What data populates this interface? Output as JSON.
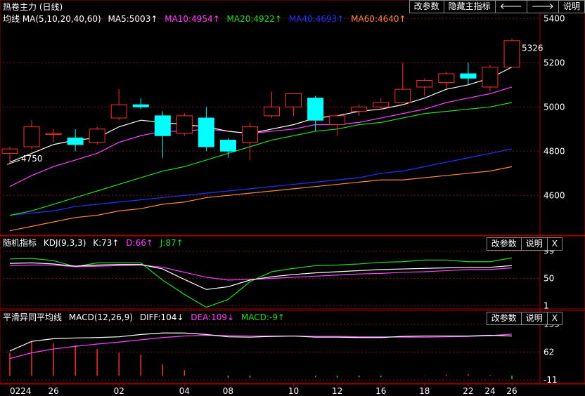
{
  "toolbar": {
    "params": "改参数",
    "hide": "隐藏主指标",
    "left": "🡐",
    "right": "🡒",
    "explain": "说明"
  },
  "main_panel": {
    "title": "热卷主力 (日线)",
    "ma_label": "均线 MA(5,10,20,40,60)",
    "ma5": "MA5:5003↑",
    "ma10": "MA10:4954↑",
    "ma20": "MA20:4922↑",
    "ma40": "MA40:4693↑",
    "ma60": "MA60:4640↑",
    "y_ticks": [
      "5400",
      "5200",
      "5000",
      "4800",
      "4600"
    ],
    "low_annotation": "4750",
    "high_annotation": "5326"
  },
  "kdj_panel": {
    "name": "随机指标",
    "params": "KDJ(9,3,3)",
    "k": "K:73↑",
    "d": "D:66↑",
    "j": "J:87↑",
    "btn_params": "改参数",
    "btn_explain": "说明",
    "btn_close": "X",
    "y_ticks": [
      "99",
      "50",
      "1"
    ]
  },
  "macd_panel": {
    "name": "平滑异同平均线",
    "params": "MACD(12,26,9)",
    "diff": "DIFF:104↓",
    "dea": "DEA:109↓",
    "macd": "MACD:-9↑",
    "btn_params": "改参数",
    "btn_explain": "说明",
    "btn_close": "X",
    "y_ticks": [
      "135",
      "62",
      "-11"
    ]
  },
  "x_axis": [
    "0224",
    "26",
    "02",
    "04",
    "08",
    "10",
    "12",
    "16",
    "18",
    "22",
    "24",
    "26"
  ],
  "colors": {
    "up": "#ff3030",
    "down": "#00ffff",
    "ma5": "#ffffff",
    "ma10": "#ff44ff",
    "ma20": "#22dd22",
    "ma40": "#2233ff",
    "ma60": "#ff8844",
    "grid": "#7a1010",
    "axis": "#a00000"
  },
  "chart_data": {
    "type": "candlestick",
    "ylim": [
      4420,
      5420
    ],
    "candles": [
      {
        "o": 4790,
        "h": 4820,
        "l": 4740,
        "c": 4810
      },
      {
        "o": 4820,
        "h": 4940,
        "l": 4810,
        "c": 4910
      },
      {
        "o": 4880,
        "h": 4900,
        "l": 4840,
        "c": 4880
      },
      {
        "o": 4860,
        "h": 4900,
        "l": 4800,
        "c": 4830
      },
      {
        "o": 4840,
        "h": 4910,
        "l": 4830,
        "c": 4900
      },
      {
        "o": 4950,
        "h": 5080,
        "l": 4940,
        "c": 5010
      },
      {
        "o": 5010,
        "h": 5040,
        "l": 4990,
        "c": 5000
      },
      {
        "o": 4960,
        "h": 4980,
        "l": 4770,
        "c": 4870
      },
      {
        "o": 4880,
        "h": 4970,
        "l": 4870,
        "c": 4960
      },
      {
        "o": 4950,
        "h": 5000,
        "l": 4800,
        "c": 4820
      },
      {
        "o": 4850,
        "h": 4860,
        "l": 4770,
        "c": 4800
      },
      {
        "o": 4840,
        "h": 4930,
        "l": 4760,
        "c": 4910
      },
      {
        "o": 4960,
        "h": 5070,
        "l": 4950,
        "c": 5000
      },
      {
        "o": 5000,
        "h": 5060,
        "l": 4960,
        "c": 5060
      },
      {
        "o": 5040,
        "h": 5050,
        "l": 4890,
        "c": 4940
      },
      {
        "o": 4920,
        "h": 4960,
        "l": 4870,
        "c": 4960
      },
      {
        "o": 4980,
        "h": 5010,
        "l": 4960,
        "c": 5000
      },
      {
        "o": 5000,
        "h": 5040,
        "l": 4990,
        "c": 5020
      },
      {
        "o": 5020,
        "h": 5200,
        "l": 5020,
        "c": 5080
      },
      {
        "o": 5090,
        "h": 5130,
        "l": 5050,
        "c": 5120
      },
      {
        "o": 5110,
        "h": 5160,
        "l": 5080,
        "c": 5150
      },
      {
        "o": 5150,
        "h": 5200,
        "l": 5100,
        "c": 5130
      },
      {
        "o": 5090,
        "h": 5190,
        "l": 5070,
        "c": 5180
      },
      {
        "o": 5180,
        "h": 5310,
        "l": 5180,
        "c": 5300
      }
    ],
    "ma5": [
      4750,
      4790,
      4830,
      4850,
      4860,
      4910,
      4940,
      4930,
      4920,
      4910,
      4890,
      4880,
      4900,
      4920,
      4950,
      4960,
      4980,
      4990,
      5010,
      5040,
      5080,
      5100,
      5130,
      5180
    ],
    "ma10": [
      4640,
      4690,
      4730,
      4760,
      4790,
      4840,
      4870,
      4890,
      4890,
      4900,
      4890,
      4880,
      4890,
      4900,
      4920,
      4920,
      4930,
      4950,
      4970,
      4990,
      5020,
      5040,
      5060,
      5090
    ],
    "ma20": [
      4510,
      4530,
      4560,
      4590,
      4620,
      4650,
      4680,
      4710,
      4730,
      4760,
      4790,
      4820,
      4850,
      4870,
      4890,
      4900,
      4920,
      4930,
      4950,
      4970,
      4980,
      4990,
      5000,
      5020
    ],
    "ma40": [
      4510,
      4520,
      4530,
      4550,
      4560,
      4570,
      4580,
      4590,
      4600,
      4610,
      4620,
      4630,
      4640,
      4650,
      4660,
      4670,
      4680,
      4700,
      4710,
      4730,
      4750,
      4770,
      4790,
      4810
    ],
    "ma60": [
      4440,
      4460,
      4480,
      4500,
      4510,
      4530,
      4540,
      4560,
      4570,
      4590,
      4600,
      4610,
      4620,
      4630,
      4640,
      4650,
      4660,
      4670,
      4670,
      4680,
      4690,
      4700,
      4710,
      4730
    ],
    "kdj_ylim": [
      -5,
      105
    ],
    "k": [
      77,
      78,
      76,
      72,
      74,
      75,
      75,
      67,
      48,
      30,
      35,
      47,
      53,
      57,
      60,
      62,
      64,
      66,
      67,
      68,
      69,
      70,
      70,
      73
    ],
    "d": [
      73,
      74,
      74,
      71,
      72,
      73,
      74,
      70,
      61,
      52,
      47,
      48,
      50,
      52,
      54,
      56,
      58,
      59,
      61,
      62,
      64,
      66,
      66,
      69
    ],
    "j": [
      85,
      86,
      82,
      71,
      78,
      78,
      78,
      47,
      21,
      -2,
      12,
      44,
      62,
      68,
      73,
      74,
      76,
      79,
      80,
      83,
      83,
      80,
      80,
      87
    ],
    "macd_ylim": [
      -20,
      140
    ],
    "diff": [
      65,
      90,
      97,
      99,
      100,
      102,
      108,
      112,
      112,
      108,
      102,
      101,
      103,
      104,
      101,
      101,
      100,
      100,
      103,
      104,
      104,
      104,
      106,
      104
    ],
    "dea": [
      45,
      60,
      70,
      77,
      83,
      88,
      94,
      100,
      104,
      106,
      105,
      104,
      104,
      104,
      103,
      103,
      102,
      102,
      101,
      101,
      102,
      103,
      105,
      109
    ],
    "macd": [
      60,
      90,
      85,
      80,
      70,
      60,
      55,
      30,
      15,
      0,
      -5,
      -5,
      0,
      0,
      -4,
      -5,
      -4,
      -4,
      0,
      1,
      3,
      4,
      2,
      -9
    ]
  }
}
